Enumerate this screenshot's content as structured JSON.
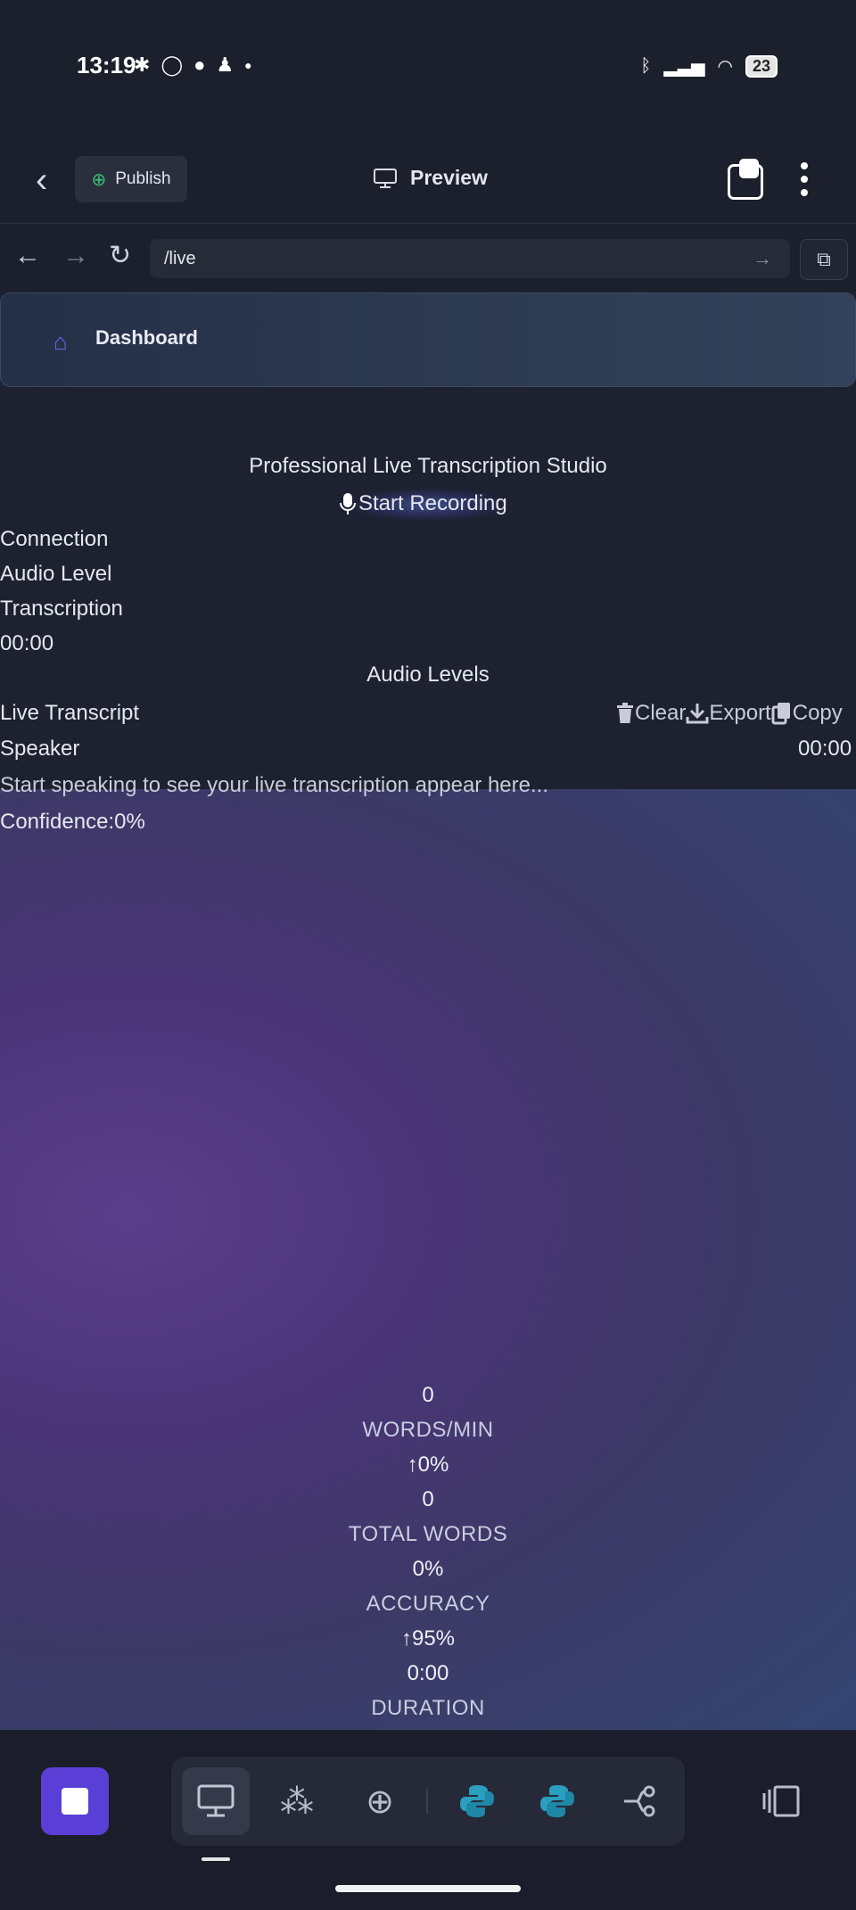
{
  "status_bar": {
    "time": "13:19",
    "notif_icons": [
      "slack-icon",
      "whatsapp-icon",
      "chat-icon",
      "snapchat-icon",
      "dot-icon"
    ],
    "battery": "23"
  },
  "app_bar": {
    "publish_label": "Publish",
    "preview_label": "Preview"
  },
  "browser": {
    "url": "/live"
  },
  "dashboard": {
    "label": "Dashboard"
  },
  "studio": {
    "title": "Professional Live Transcription Studio",
    "record_label": "Start Recording",
    "connection_label": "Connection",
    "audio_level_label": "Audio Level",
    "transcription_label": "Transcription",
    "timer": "00:00",
    "audio_levels_title": "Audio Levels"
  },
  "transcript": {
    "title": "Live Transcript",
    "clear_label": "Clear",
    "export_label": "Export",
    "copy_label": "Copy",
    "speaker_label": "Speaker",
    "speaker_time": "00:00",
    "placeholder": "Start speaking to see your live transcription appear here...",
    "confidence_label": "Confidence:",
    "confidence_value": "0%"
  },
  "stats": {
    "wpm_value": "0",
    "wpm_label": "WORDS/MIN",
    "wpm_change": "0%",
    "total_value": "0",
    "total_label": "TOTAL WORDS",
    "total_change": "0%",
    "accuracy_label": "ACCURACY",
    "accuracy_change": "95%",
    "duration_value": "0:00",
    "duration_label": "DURATION"
  },
  "colors": {
    "accent": "#5a3fd6",
    "background": "#1d2130",
    "publish_icon": "#36c27a",
    "home_icon": "#6a67ee"
  }
}
